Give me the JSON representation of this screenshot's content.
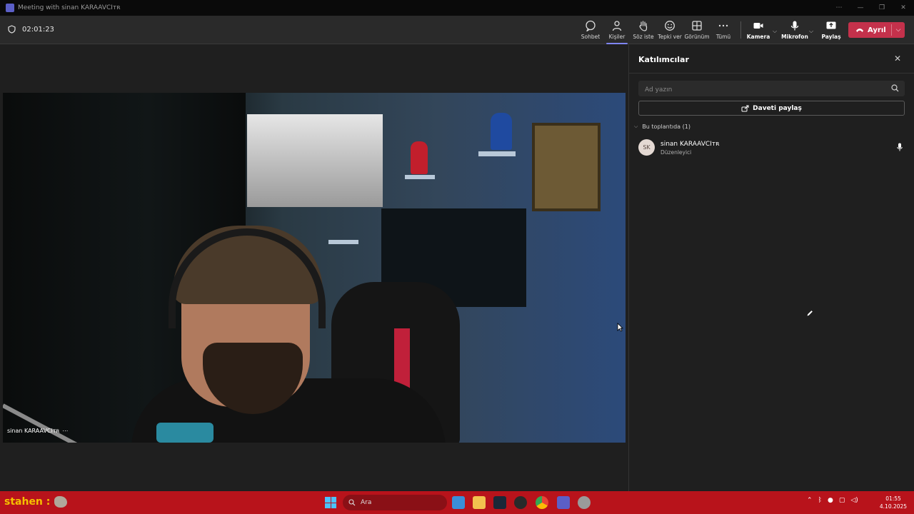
{
  "window": {
    "title": "Meeting with sinan KARAAVCIᴛʀ",
    "controls": [
      "⋯",
      "—",
      "❒",
      "✕"
    ]
  },
  "toolbar": {
    "timer": "02:01:23",
    "buttons": {
      "chat": "Sohbet",
      "people": "Kişiler",
      "raise_hand": "Söz iste",
      "react": "Tepki ver",
      "view": "Görünüm",
      "more": "Tümü",
      "camera": "Kamera",
      "mic": "Mikrofon",
      "share": "Paylaş"
    },
    "leave": "Ayrıl"
  },
  "video": {
    "participant_name": "sinan KARAAVCIᴛʀ",
    "more": "⋯"
  },
  "panel": {
    "title": "Katılımcılar",
    "search_placeholder": "Ad yazın",
    "share_invite": "Daveti paylaş",
    "section_label": "Bu toplantıda (1)",
    "participants": [
      {
        "initials": "SK",
        "name": "sinan KARAAVCIᴛʀ",
        "role": "Düzenleyici"
      }
    ]
  },
  "taskbar": {
    "streamer_text": "stahen :",
    "search_placeholder": "Ara",
    "time": "01:55",
    "date": "4.10.2025"
  },
  "colors": {
    "accent": "#7f85f5",
    "leave": "#c4314b",
    "taskbar": "#b8131b"
  }
}
